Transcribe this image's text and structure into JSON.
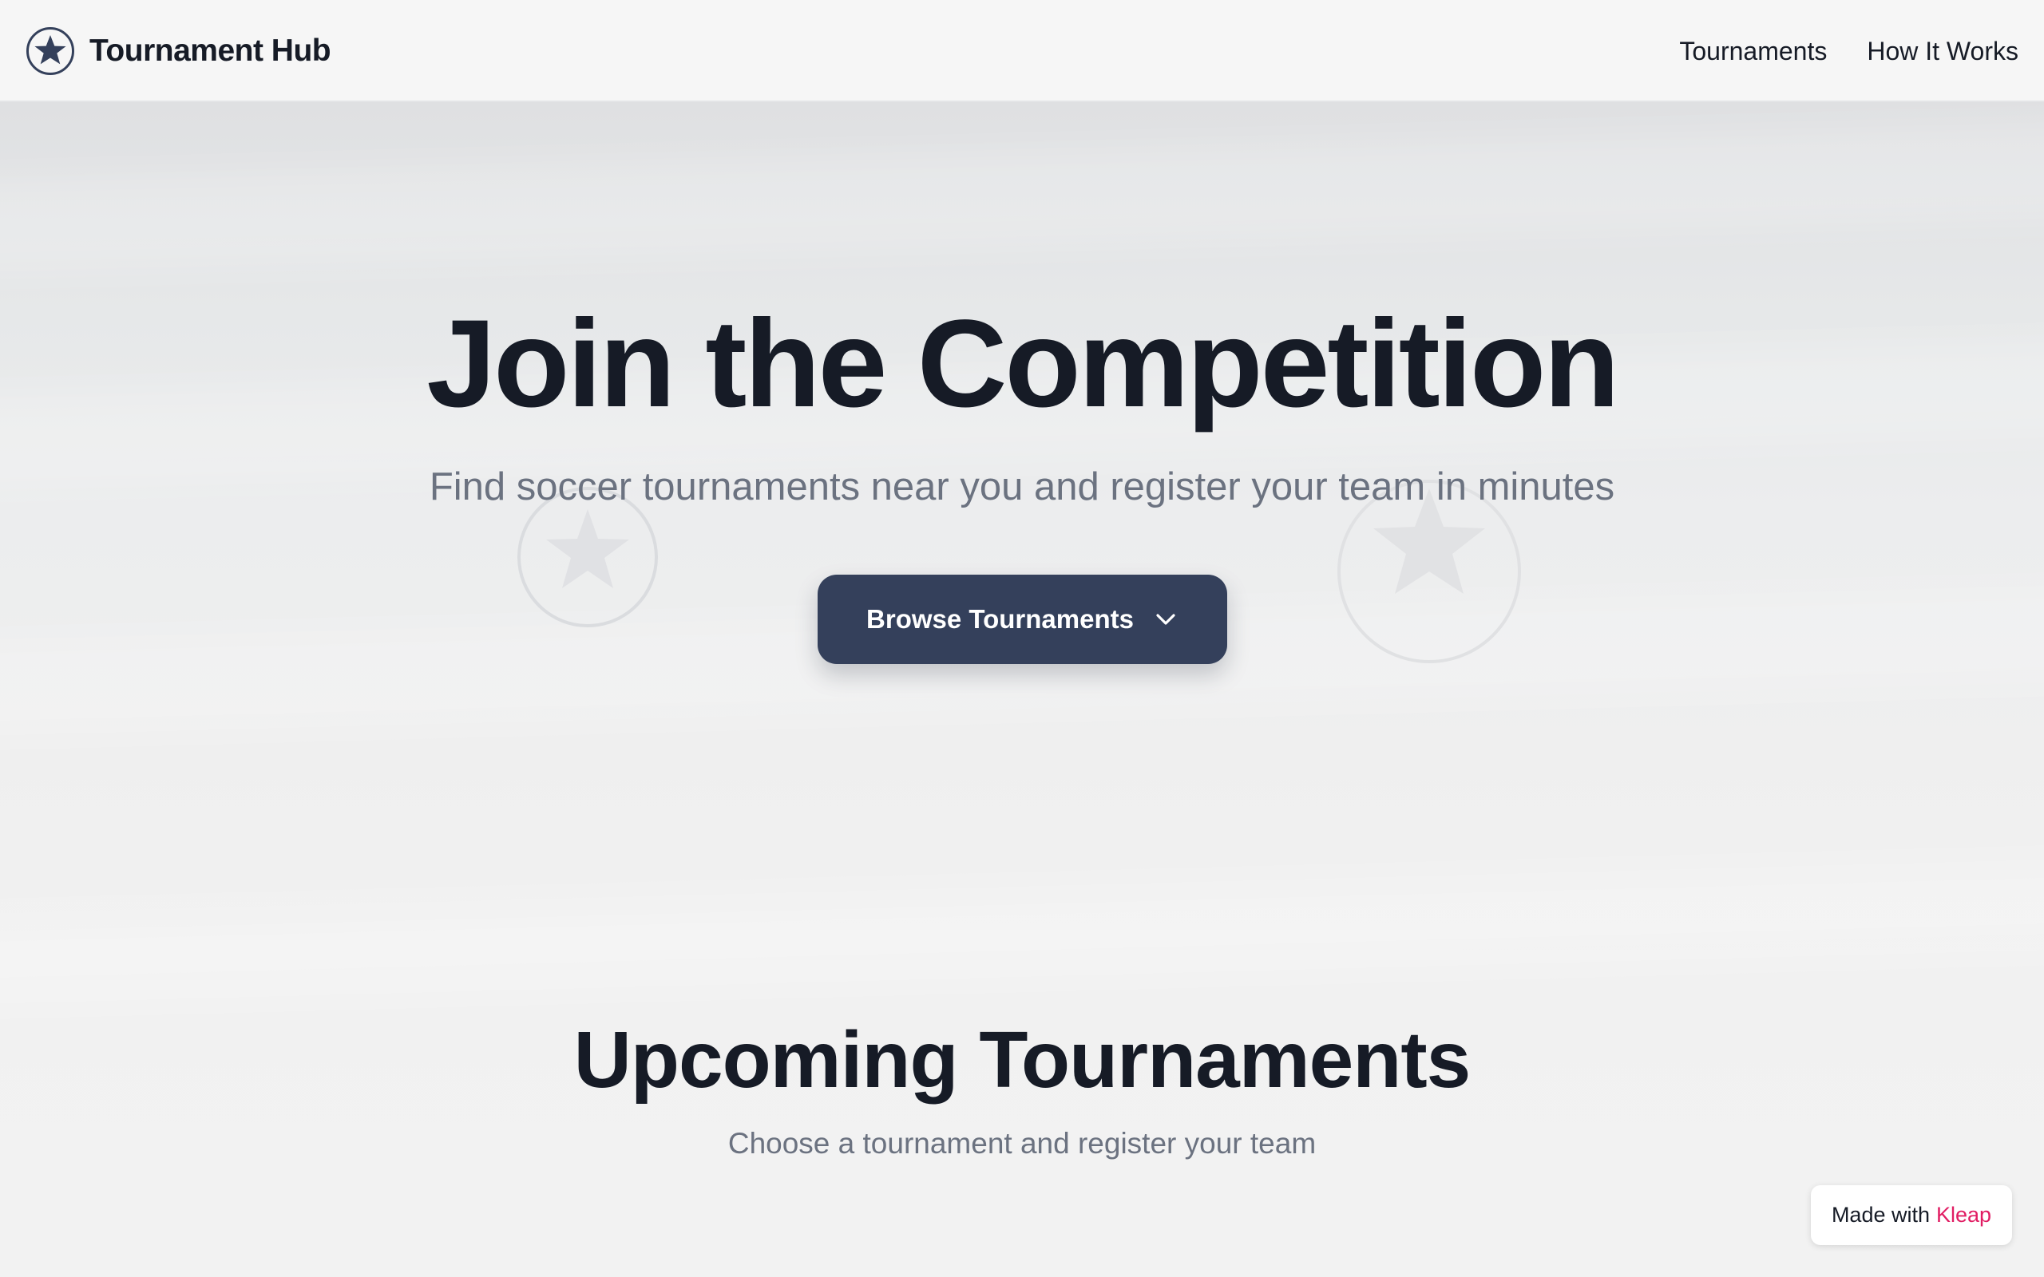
{
  "header": {
    "brand_name": "Tournament Hub",
    "logo_icon": "star-circle-icon",
    "nav": [
      {
        "label": "Tournaments"
      },
      {
        "label": "How It Works"
      }
    ]
  },
  "hero": {
    "title": "Join the Competition",
    "subtitle": "Find soccer tournaments near you and register your team in minutes",
    "cta_label": "Browse Tournaments",
    "cta_icon": "chevron-down-icon",
    "decor_icons": [
      "star-circle-icon",
      "star-circle-icon"
    ]
  },
  "upcoming": {
    "title": "Upcoming Tournaments",
    "subtitle": "Choose a tournament and register your team"
  },
  "badge": {
    "prefix": "Made with",
    "brand": "Kleap"
  },
  "colors": {
    "text_primary": "#161b26",
    "text_muted": "#6b7280",
    "button_bg": "#34405b",
    "badge_accent": "#e11d63",
    "header_bg": "#f6f6f6"
  }
}
